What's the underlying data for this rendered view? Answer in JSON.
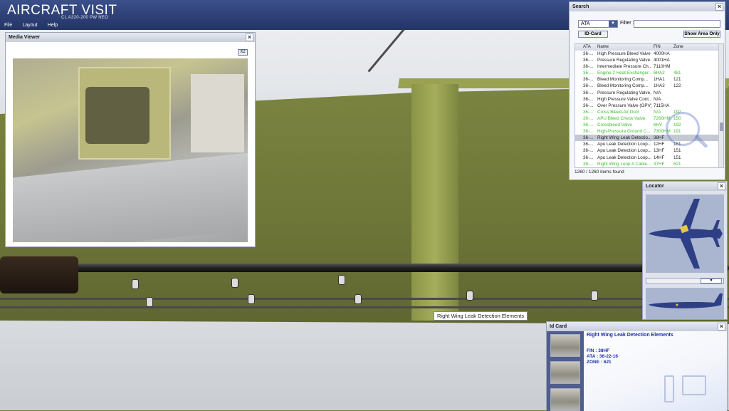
{
  "app": {
    "logo": "AIRCRAFT VISIT",
    "subtitle": "CL A320-200 PW NEO"
  },
  "menu": [
    {
      "label": "File"
    },
    {
      "label": "Layout"
    },
    {
      "label": "Help"
    }
  ],
  "tooltip": "Right Wing Leak Detection Elements",
  "media_viewer": {
    "title": "Media Viewer",
    "zoom_label": "X2",
    "close": "×"
  },
  "search": {
    "title": "Search",
    "close": "×",
    "category_selected": "ATA",
    "filter_label": "Filter :",
    "filter_value": "",
    "id_card_button": "ID-Card",
    "show_area_button": "Show Area Only",
    "columns": [
      "ATA",
      "Name",
      "FIN",
      "Zone"
    ],
    "rows": [
      {
        "ata": "36-...",
        "name": "High Pressure Bleed Valve ...",
        "fin": "4000HA",
        "zone": "",
        "style": "normal"
      },
      {
        "ata": "36-...",
        "name": "Pressure Regulating Valve...",
        "fin": "4001HA",
        "zone": "",
        "style": "normal"
      },
      {
        "ata": "36-...",
        "name": "Intermediate Pressure Ch...",
        "fin": "7110HM",
        "zone": "",
        "style": "normal"
      },
      {
        "ata": "36-...",
        "name": "Engine 2 Heat-Exchanger...",
        "fin": "6HA2",
        "zone": "481",
        "style": "green"
      },
      {
        "ata": "36-...",
        "name": "Bleed Monitoring Comp...",
        "fin": "1HA1",
        "zone": "121",
        "style": "normal"
      },
      {
        "ata": "36-...",
        "name": "Bleed Monitoring Comp...",
        "fin": "1HA2",
        "zone": "122",
        "style": "normal"
      },
      {
        "ata": "36-...",
        "name": "Pressure Regulating Valve...",
        "fin": "N/A",
        "zone": "",
        "style": "normal"
      },
      {
        "ata": "36-...",
        "name": "High Pressure Valve Cont...",
        "fin": "N/A",
        "zone": "",
        "style": "normal"
      },
      {
        "ata": "36-...",
        "name": "Over Pressure Valve (OPV)",
        "fin": "7115HA",
        "zone": "",
        "style": "normal"
      },
      {
        "ata": "36-...",
        "name": "Cross Bleed-Air Duct",
        "fin": "N/A",
        "zone": "192",
        "style": "green"
      },
      {
        "ata": "36-...",
        "name": "APU Bleed Check Valve",
        "fin": "7260HM",
        "zone": "150",
        "style": "green"
      },
      {
        "ata": "36-...",
        "name": "Crossbleed Valve",
        "fin": "6HV",
        "zone": "192",
        "style": "green"
      },
      {
        "ata": "36-...",
        "name": "High-Pressure Ground C...",
        "fin": "7300HM",
        "zone": "191",
        "style": "green"
      },
      {
        "ata": "36-...",
        "name": "Right Wing Leak Detectio...",
        "fin": "38HF",
        "zone": "",
        "style": "selected"
      },
      {
        "ata": "36-...",
        "name": "Apu Leak Detection Loop...",
        "fin": "12HF",
        "zone": "151",
        "style": "normal"
      },
      {
        "ata": "36-...",
        "name": "Apu Leak Detection Loop...",
        "fin": "13HF",
        "zone": "151",
        "style": "normal"
      },
      {
        "ata": "36-...",
        "name": "Apu Leak Detection Loop...",
        "fin": "14HF",
        "zone": "151",
        "style": "normal"
      },
      {
        "ata": "36-...",
        "name": "Right Wing Loop A Cable...",
        "fin": "37HF",
        "zone": "621",
        "style": "green"
      }
    ],
    "count_text": "1260 / 1260 items found"
  },
  "locator": {
    "title": "Locator",
    "close": "×",
    "dropdown_arrow": "▼"
  },
  "id_card": {
    "title": "Id Card",
    "close": "×",
    "item_title": "Right Wing Leak Detection Elements",
    "fin": "FIN : 38HF",
    "ata": "ATA : 36-22-16",
    "zone": "ZONE : 621"
  },
  "colors": {
    "header": "#2a3c70",
    "accent": "#1a2fa8",
    "green_row": "#3cbf2e"
  }
}
